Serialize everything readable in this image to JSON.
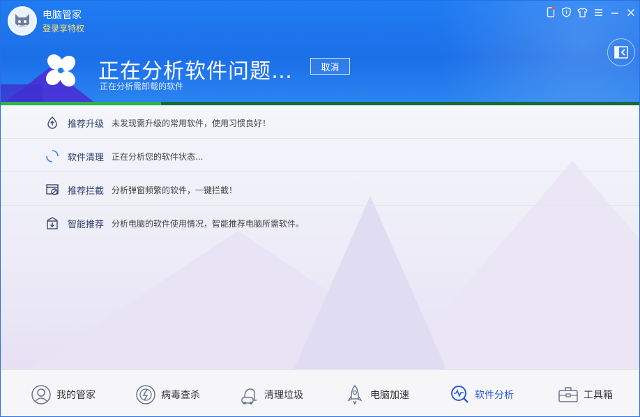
{
  "app": {
    "title": "电脑管家",
    "login_link": "登录享特权"
  },
  "window_controls": {
    "icons": [
      "phone-icon",
      "shield-icon",
      "shirt-icon",
      "menu-icon",
      "minimize-icon",
      "close-icon"
    ]
  },
  "status": {
    "title": "正在分析软件问题…",
    "cancel_label": "取消",
    "subtitle": "正在分析需卸载的软件",
    "progress": 0.25
  },
  "rows": [
    {
      "name": "推荐升级",
      "desc": "未发现需升级的常用软件，使用习惯良好！",
      "icon": "upgrade-icon"
    },
    {
      "name": "软件清理",
      "desc": "正在分析您的软件状态...",
      "icon": "spinner-icon"
    },
    {
      "name": "推荐拦截",
      "desc": "分析弹窗频繁的软件，一键拦截！",
      "icon": "block-icon"
    },
    {
      "name": "智能推荐",
      "desc": "分析电脑的软件使用情况，智能推荐电脑所需软件。",
      "icon": "recommend-icon"
    }
  ],
  "nav": {
    "items": [
      {
        "label": "我的管家",
        "icon": "butler-icon"
      },
      {
        "label": "病毒查杀",
        "icon": "virus-scan-icon"
      },
      {
        "label": "清理垃圾",
        "icon": "vacuum-icon"
      },
      {
        "label": "电脑加速",
        "icon": "rocket-icon"
      },
      {
        "label": "软件分析",
        "icon": "software-analysis-icon"
      },
      {
        "label": "工具箱",
        "icon": "toolbox-icon"
      }
    ],
    "active_index": 4
  },
  "colors": {
    "header_blue": "#1f7cf2",
    "progress_green": "#2fb44c",
    "login_yellow": "#ffe36b",
    "active_nav": "#2b5bd6"
  }
}
